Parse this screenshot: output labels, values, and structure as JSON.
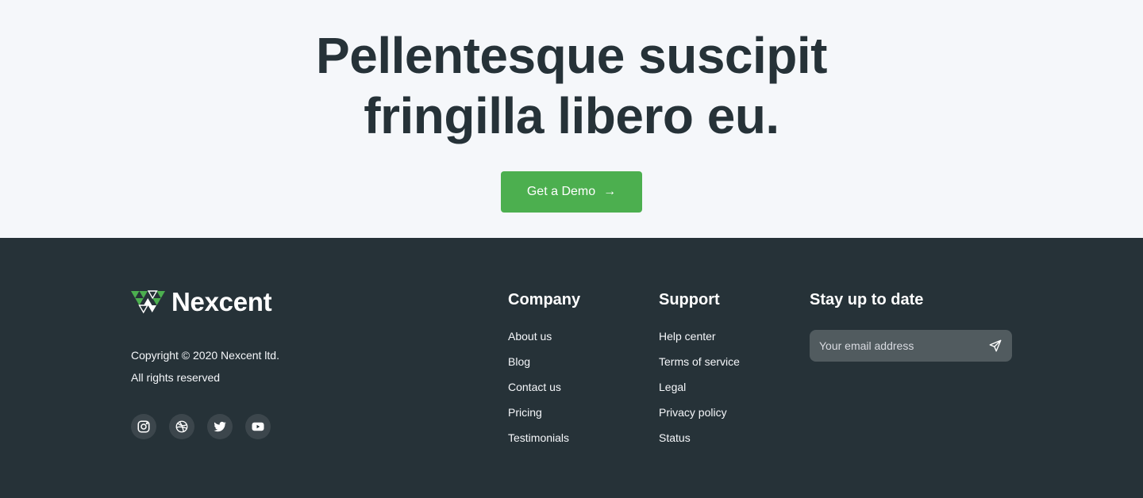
{
  "hero": {
    "title_line1": "Pellentesque suscipit",
    "title_line2": "fringilla libero eu.",
    "cta_label": "Get a Demo",
    "cta_arrow": "→"
  },
  "footer": {
    "brand": "Nexcent",
    "copyright_line1": "Copyright © 2020 Nexcent ltd.",
    "copyright_line2": "All rights reserved",
    "socials": [
      "instagram-icon",
      "dribbble-icon",
      "twitter-icon",
      "youtube-icon"
    ],
    "company": {
      "heading": "Company",
      "links": [
        "About us",
        "Blog",
        "Contact us",
        "Pricing",
        "Testimonials"
      ]
    },
    "support": {
      "heading": "Support",
      "links": [
        "Help center",
        "Terms of service",
        "Legal",
        "Privacy policy",
        "Status"
      ]
    },
    "newsletter": {
      "heading": "Stay up to date",
      "placeholder": "Your email address",
      "icon": "send-icon"
    }
  },
  "colors": {
    "accent": "#4CAF4F",
    "dark": "#263238",
    "light": "#F5F7FA"
  }
}
